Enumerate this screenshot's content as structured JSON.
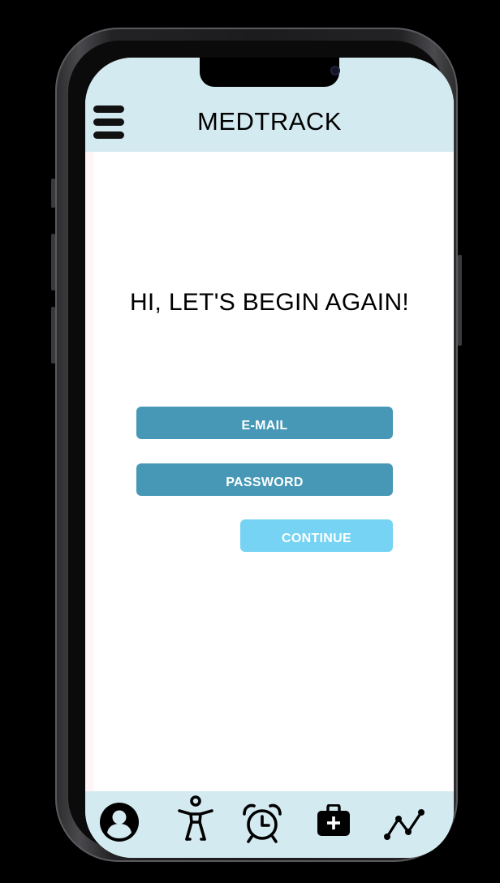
{
  "header": {
    "title": "MEDTRACK",
    "menu_icon": "hamburger-menu-icon"
  },
  "main": {
    "greeting": "HI, LET'S BEGIN AGAIN!",
    "email_placeholder": "E-MAIL",
    "password_placeholder": "PASSWORD",
    "continue_label": "CONTINUE"
  },
  "tabbar": {
    "tabs": [
      {
        "icon": "profile-icon"
      },
      {
        "icon": "body-icon"
      },
      {
        "icon": "alarm-clock-icon"
      },
      {
        "icon": "medical-kit-icon"
      },
      {
        "icon": "trend-chart-icon"
      }
    ]
  },
  "colors": {
    "header_bg": "#d4eaf1",
    "field_bg": "#4698b6",
    "continue_bg": "#76d3f3",
    "tabbar_bg": "#d4eaf1"
  }
}
